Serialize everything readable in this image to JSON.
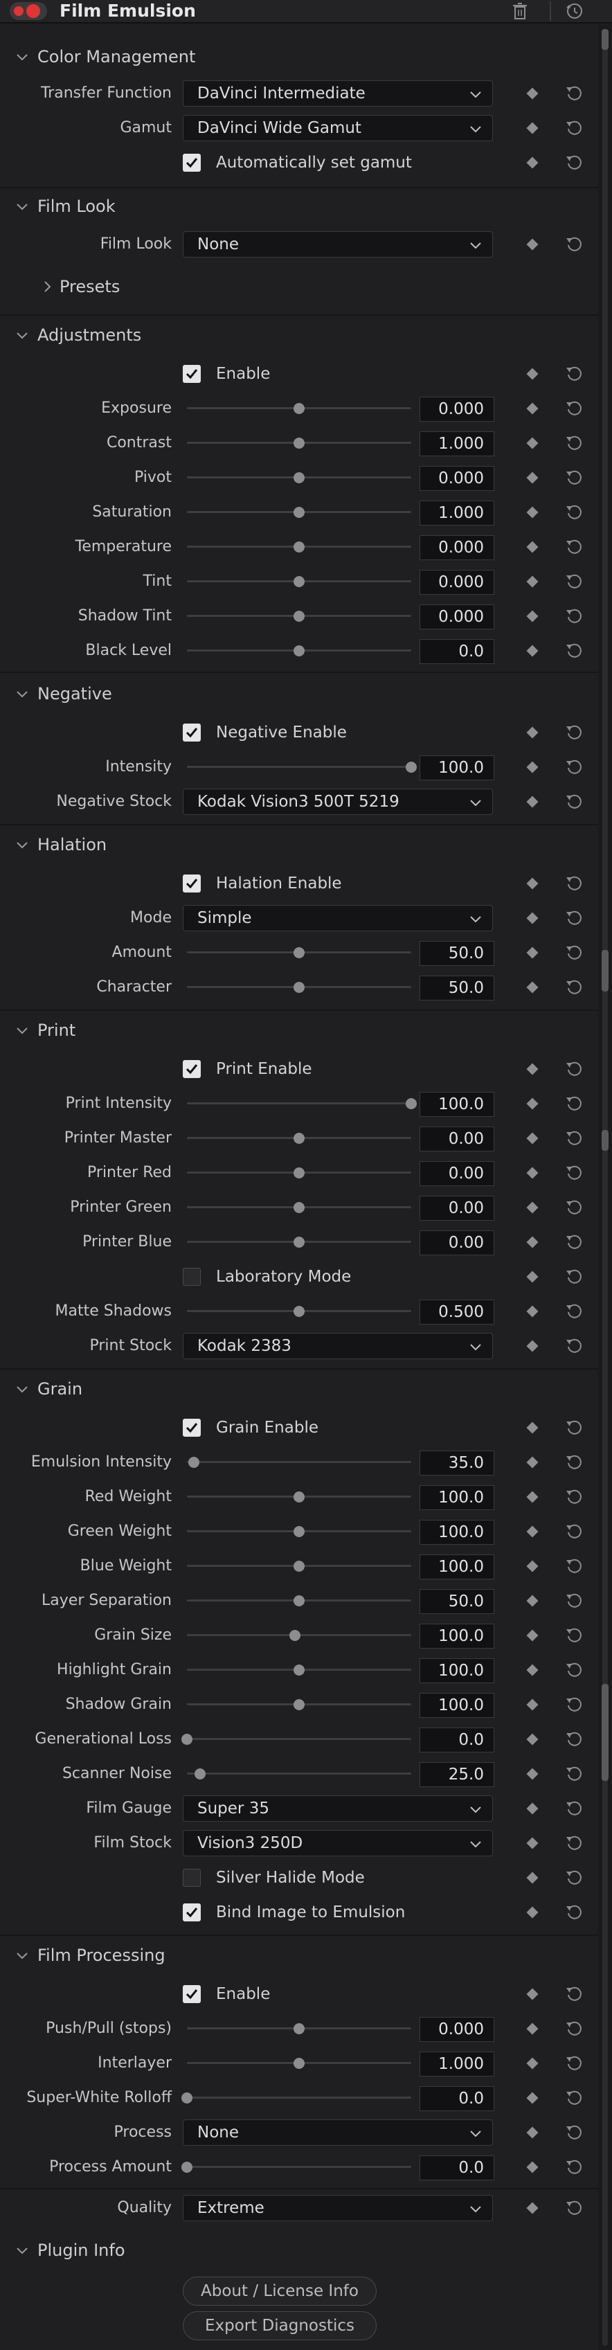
{
  "header": {
    "title": "Film Emulsion"
  },
  "panel": {
    "color_management": {
      "label": "Color Management",
      "transfer_function": {
        "label": "Transfer Function",
        "value": "DaVinci Intermediate"
      },
      "gamut": {
        "label": "Gamut",
        "value": "DaVinci Wide Gamut"
      },
      "auto_gamut": {
        "label": "Automatically set gamut",
        "checked": true
      }
    },
    "film_look": {
      "label": "Film Look",
      "film_look": {
        "label": "Film Look",
        "value": "None"
      },
      "presets": {
        "label": "Presets"
      }
    },
    "adjustments": {
      "label": "Adjustments",
      "enable": {
        "label": "Enable",
        "checked": true
      },
      "params": [
        {
          "label": "Exposure",
          "value": "0.000",
          "level": 0.5
        },
        {
          "label": "Contrast",
          "value": "1.000",
          "level": 0.5
        },
        {
          "label": "Pivot",
          "value": "0.000",
          "level": 0.5
        },
        {
          "label": "Saturation",
          "value": "1.000",
          "level": 0.5
        },
        {
          "label": "Temperature",
          "value": "0.000",
          "level": 0.5
        },
        {
          "label": "Tint",
          "value": "0.000",
          "level": 0.5
        },
        {
          "label": "Shadow Tint",
          "value": "0.000",
          "level": 0.5
        },
        {
          "label": "Black Level",
          "value": "0.0",
          "level": 0.5
        }
      ]
    },
    "negative": {
      "label": "Negative",
      "enable": {
        "label": "Negative Enable",
        "checked": true
      },
      "intensity": {
        "label": "Intensity",
        "value": "100.0",
        "level": 1.0
      },
      "stock": {
        "label": "Negative Stock",
        "value": "Kodak Vision3 500T 5219"
      }
    },
    "halation": {
      "label": "Halation",
      "enable": {
        "label": "Halation Enable",
        "checked": true
      },
      "mode": {
        "label": "Mode",
        "value": "Simple"
      },
      "amount": {
        "label": "Amount",
        "value": "50.0",
        "level": 0.5
      },
      "character": {
        "label": "Character",
        "value": "50.0",
        "level": 0.5
      }
    },
    "print": {
      "label": "Print",
      "enable": {
        "label": "Print Enable",
        "checked": true
      },
      "params": [
        {
          "label": "Print Intensity",
          "value": "100.0",
          "level": 1.0
        },
        {
          "label": "Printer Master",
          "value": "0.00",
          "level": 0.5
        },
        {
          "label": "Printer Red",
          "value": "0.00",
          "level": 0.5
        },
        {
          "label": "Printer Green",
          "value": "0.00",
          "level": 0.5
        },
        {
          "label": "Printer Blue",
          "value": "0.00",
          "level": 0.5
        }
      ],
      "lab_mode": {
        "label": "Laboratory Mode",
        "checked": false
      },
      "matte_shadows": {
        "label": "Matte Shadows",
        "value": "0.500",
        "level": 0.5
      },
      "stock": {
        "label": "Print Stock",
        "value": "Kodak 2383"
      }
    },
    "grain": {
      "label": "Grain",
      "enable": {
        "label": "Grain Enable",
        "checked": true
      },
      "params": [
        {
          "label": "Emulsion Intensity",
          "value": "35.0",
          "level": 0.03
        },
        {
          "label": "Red Weight",
          "value": "100.0",
          "level": 0.5
        },
        {
          "label": "Green Weight",
          "value": "100.0",
          "level": 0.5
        },
        {
          "label": "Blue Weight",
          "value": "100.0",
          "level": 0.5
        },
        {
          "label": "Layer Separation",
          "value": "50.0",
          "level": 0.5
        },
        {
          "label": "Grain Size",
          "value": "100.0",
          "level": 0.48
        },
        {
          "label": "Highlight Grain",
          "value": "100.0",
          "level": 0.5
        },
        {
          "label": "Shadow Grain",
          "value": "100.0",
          "level": 0.5
        },
        {
          "label": "Generational Loss",
          "value": "0.0",
          "level": 0.0
        },
        {
          "label": "Scanner Noise",
          "value": "25.0",
          "level": 0.06
        }
      ],
      "film_gauge": {
        "label": "Film Gauge",
        "value": "Super 35"
      },
      "film_stock": {
        "label": "Film Stock",
        "value": "Vision3 250D"
      },
      "silver_halide": {
        "label": "Silver Halide Mode",
        "checked": false
      },
      "bind_image": {
        "label": "Bind Image to Emulsion",
        "checked": true
      }
    },
    "film_processing": {
      "label": "Film Processing",
      "enable": {
        "label": "Enable",
        "checked": true
      },
      "push_pull": {
        "label": "Push/Pull (stops)",
        "value": "0.000",
        "level": 0.5
      },
      "interlayer": {
        "label": "Interlayer",
        "value": "1.000",
        "level": 0.5
      },
      "white_rolloff": {
        "label": "Super-White Rolloff",
        "value": "0.0",
        "level": 0.0
      },
      "process": {
        "label": "Process",
        "value": "None"
      },
      "process_amount": {
        "label": "Process Amount",
        "value": "0.0",
        "level": 0.0
      }
    },
    "quality": {
      "label": "Quality",
      "value": "Extreme"
    },
    "plugin_info": {
      "label": "Plugin Info",
      "about_button": "About / License Info",
      "export_button": "Export Diagnostics"
    }
  }
}
